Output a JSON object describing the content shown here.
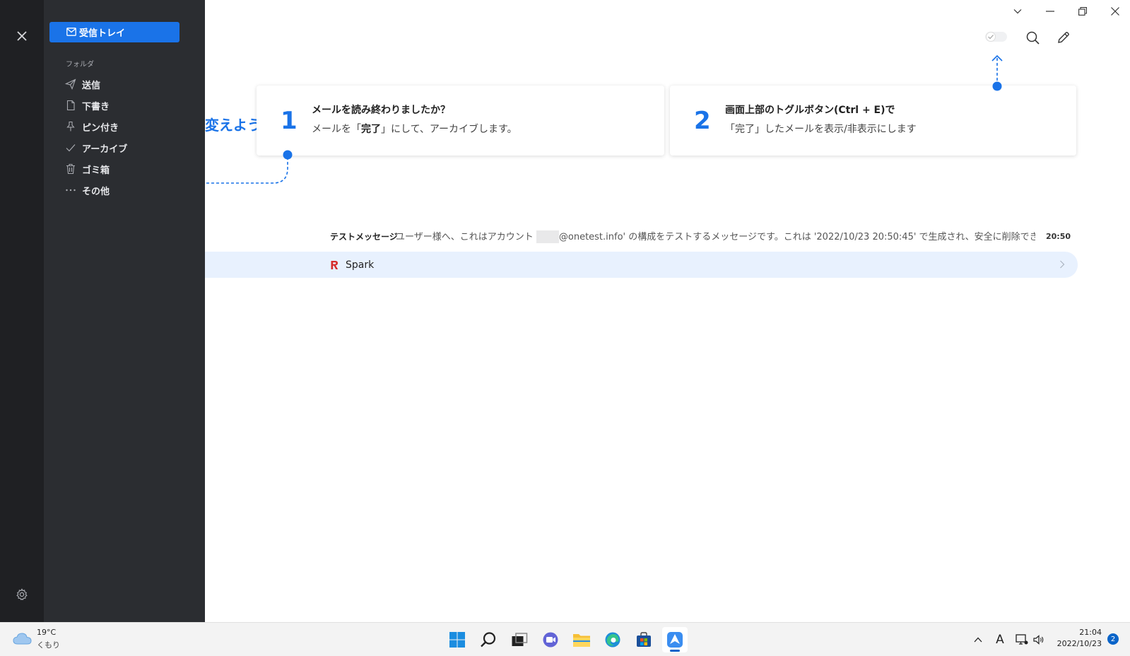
{
  "sidebar": {
    "inbox_label": "受信トレイ",
    "folders_heading": "フォルダ",
    "folders": [
      {
        "label": "送信",
        "icon": "send-icon"
      },
      {
        "label": "下書き",
        "icon": "draft-icon"
      },
      {
        "label": "ピン付き",
        "icon": "pin-icon"
      },
      {
        "label": "アーカイブ",
        "icon": "check-icon"
      },
      {
        "label": "ゴミ箱",
        "icon": "trash-icon"
      },
      {
        "label": "その他",
        "icon": "more-icon"
      }
    ]
  },
  "onboarding": {
    "partial_heading": "変えよう",
    "cards": [
      {
        "number": "1",
        "title": "メールを読み終わりましたか？",
        "desc_before": "メールを「",
        "desc_bold": "完了",
        "desc_after": "」にして、アーカイブします。"
      },
      {
        "number": "2",
        "title": "画面上部のトグルボタン(Ctrl + E)で",
        "desc": "「完了」したメールを表示/非表示にします"
      }
    ]
  },
  "messages": [
    {
      "sender": "テストメッセージ",
      "preview_before": "ユーザー様へ、これはアカウント ",
      "preview_after": "@onetest.info' の構成をテストするメッセージです。これは '2022/10/23 20:50:45' で生成され、安全に削除できます。",
      "time": "20:50"
    }
  ],
  "group_row": {
    "name": "Spark"
  },
  "taskbar": {
    "weather": {
      "temp": "19°C",
      "condition": "くもり"
    },
    "apps": [
      "start-icon",
      "search-icon",
      "task-view-icon",
      "chat-icon",
      "file-explorer-icon",
      "edge-icon",
      "store-icon",
      "spark-icon"
    ],
    "ime_label": "A",
    "time": "21:04",
    "date": "2022/10/23",
    "notification_count": "2"
  },
  "colors": {
    "accent": "#1a73e8",
    "sidebar_bg": "#2b2d31",
    "rail_bg": "#1f2023",
    "selected_row_bg": "#e8f1fe"
  }
}
